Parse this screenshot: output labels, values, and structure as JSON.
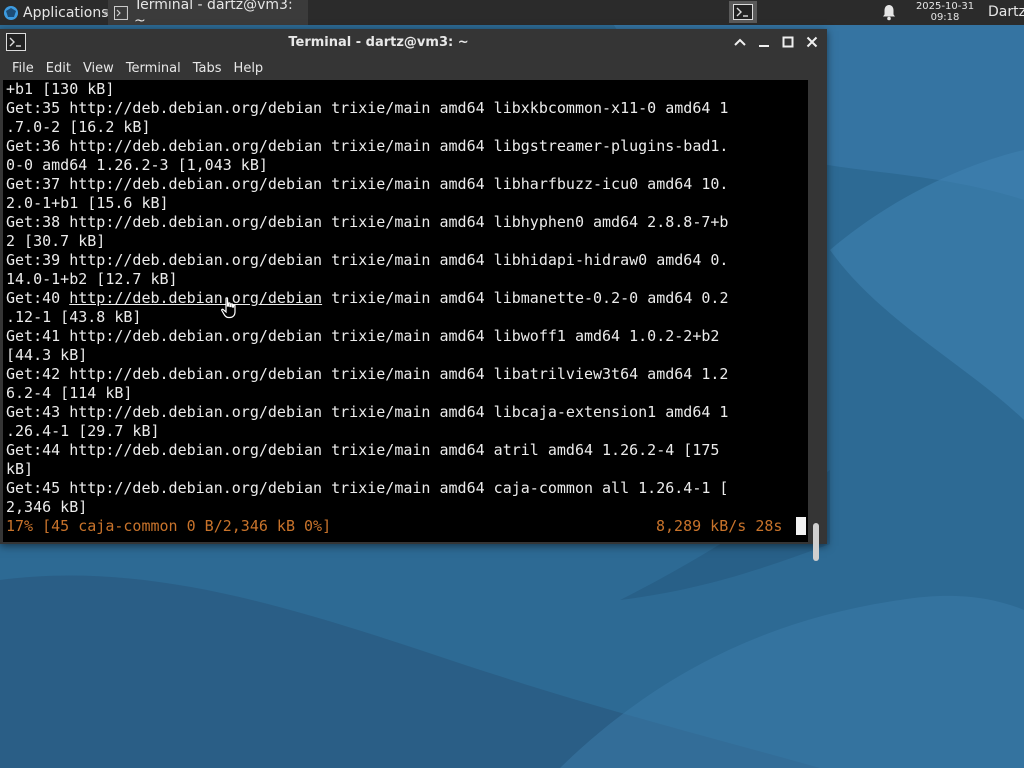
{
  "panel": {
    "apps_label": "Applications",
    "apps_sep": "≡",
    "task_label": "Terminal - dartz@vm3: ~",
    "clock_date": "2025-10-31",
    "clock_time": "09:18",
    "user": "Dartz"
  },
  "window": {
    "title": "Terminal - dartz@vm3: ~",
    "menu": [
      "File",
      "Edit",
      "View",
      "Terminal",
      "Tabs",
      "Help"
    ]
  },
  "terminal": {
    "lines": [
      "+b1 [130 kB]",
      "Get:35 http://deb.debian.org/debian trixie/main amd64 libxkbcommon-x11-0 amd64 1",
      ".7.0-2 [16.2 kB]",
      "Get:36 http://deb.debian.org/debian trixie/main amd64 libgstreamer-plugins-bad1.",
      "0-0 amd64 1.26.2-3 [1,043 kB]",
      "Get:37 http://deb.debian.org/debian trixie/main amd64 libharfbuzz-icu0 amd64 10.",
      "2.0-1+b1 [15.6 kB]",
      "Get:38 http://deb.debian.org/debian trixie/main amd64 libhyphen0 amd64 2.8.8-7+b",
      "2 [30.7 kB]",
      "Get:39 http://deb.debian.org/debian trixie/main amd64 libhidapi-hidraw0 amd64 0.",
      "14.0-1+b2 [12.7 kB]",
      "__LINK__",
      ".12-1 [43.8 kB]",
      "Get:41 http://deb.debian.org/debian trixie/main amd64 libwoff1 amd64 1.0.2-2+b2",
      "[44.3 kB]",
      "Get:42 http://deb.debian.org/debian trixie/main amd64 libatrilview3t64 amd64 1.2",
      "6.2-4 [114 kB]",
      "Get:43 http://deb.debian.org/debian trixie/main amd64 libcaja-extension1 amd64 1",
      ".26.4-1 [29.7 kB]",
      "Get:44 http://deb.debian.org/debian trixie/main amd64 atril amd64 1.26.2-4 [175",
      "kB]",
      "Get:45 http://deb.debian.org/debian trixie/main amd64 caja-common all 1.26.4-1 [",
      "2,346 kB]"
    ],
    "link_line": {
      "prefix": "Get:40 ",
      "url": "http://deb.debian.org/debian",
      "suffix": " trixie/main amd64 libmanette-0.2-0 amd64 0.2"
    },
    "status_left": "17% [45 caja-common 0 B/2,346 kB 0%]",
    "status_right": "8,289 kB/s 28s",
    "status_color": "#c8732b"
  }
}
